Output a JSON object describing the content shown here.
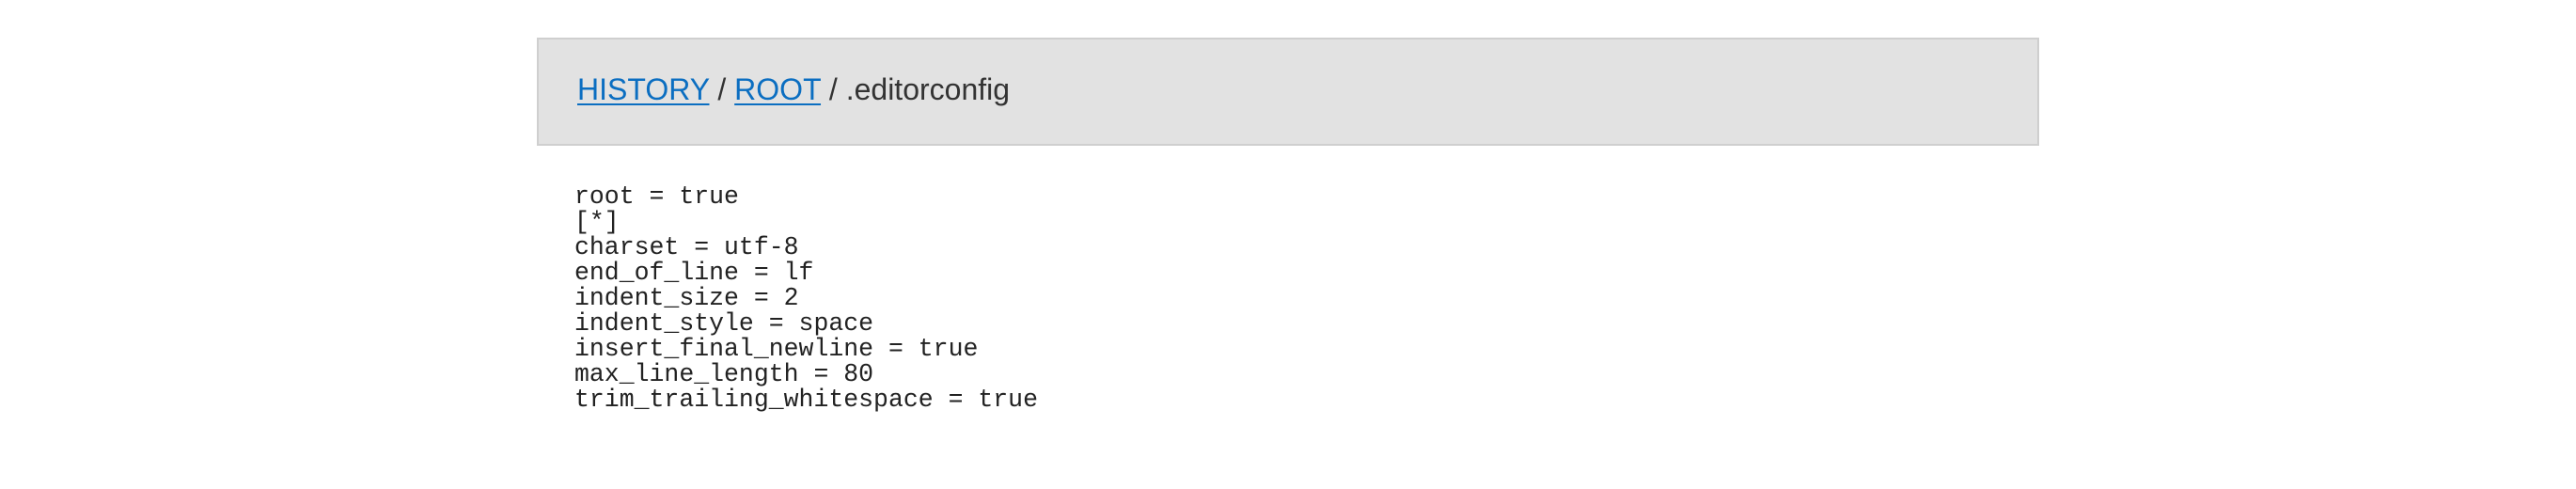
{
  "breadcrumb": {
    "history_label": "HISTORY",
    "separator_1": " / ",
    "root_label": "ROOT",
    "separator_2": " / ",
    "current_file": ".editorconfig"
  },
  "file_content": {
    "lines": [
      "root = true",
      "[*]",
      "charset = utf-8",
      "end_of_line = lf",
      "indent_size = 2",
      "indent_style = space",
      "insert_final_newline = true",
      "max_line_length = 80",
      "trim_trailing_whitespace = true"
    ]
  },
  "colors": {
    "header_background": "#e2e2e2",
    "link": "#0b6ec1",
    "text": "#333333"
  }
}
